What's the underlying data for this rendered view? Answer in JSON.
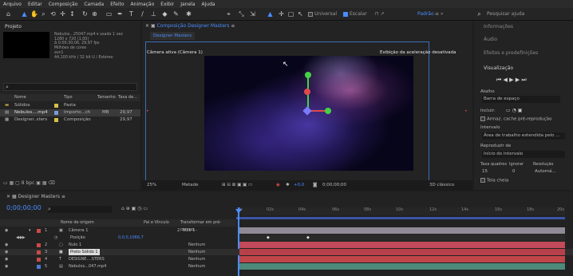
{
  "menubar": [
    "Arquivo",
    "Editar",
    "Composição",
    "Camada",
    "Efeito",
    "Animação",
    "Exibir",
    "Janela",
    "Ajuda"
  ],
  "toolbar": {
    "universal_label": "Universal",
    "escalar_label": "Escalar",
    "padrao_label": "Padrão",
    "search_placeholder": "Pesquisar ajuda"
  },
  "project": {
    "title": "Projeto",
    "info_lines": [
      "Nebulos...25047.mp4 ▾ usado 1 vez",
      "1280 x 720 (1,00)",
      "Δ 0;00;30;06, 29,97 fps",
      "Milhões de cores",
      "avc1",
      "44,100 kHz / 32 bit U / Estéreo"
    ],
    "columns": [
      "Nome",
      "Tipo",
      "Tamanho",
      "Taxa de..."
    ],
    "items": [
      {
        "name": "Sólidos",
        "type": "Pasta",
        "size": "",
        "rate": "",
        "color": "#d4c24a"
      },
      {
        "name": "Nebulos....mp4",
        "type": "Importo...ch",
        "size": "MB",
        "rate": "29,97",
        "color": "#7a9ad8"
      },
      {
        "name": "Designer..sters",
        "type": "Composição",
        "size": "",
        "rate": "29,97",
        "color": "#d4c24a"
      }
    ],
    "bpc": "8 bpc"
  },
  "composition": {
    "tab": "Composição Designer Masters",
    "sub_tab": "Designer Masters",
    "active_camera": "Câmera ativa (Câmera 1)",
    "accel_note": "Exibição da aceleração desativada",
    "zoom": "25%",
    "quality": "Metade",
    "timecode": "0;00;00;00",
    "view": "3D clássico",
    "exposure": "+0,0"
  },
  "right_panel": {
    "items": [
      "Informações",
      "Áudio",
      "Efeitos e predefinições"
    ],
    "visualization": "Visualização",
    "shortcut_label": "Atalho",
    "shortcut_value": "Barra de espaço",
    "include_label": "Incluir:",
    "cache_label": "Armaz. cache pré-reprodução",
    "interval_label": "Intervalo",
    "interval_value": "Área de trabalho estendida pelo ...",
    "play_from_label": "Reproduzir de",
    "play_from_value": "Início do intervalo",
    "fps_label": "Taxa quadros",
    "skip_label": "Ignorar",
    "res_label": "Resolução",
    "fps_value": "15",
    "skip_value": "0",
    "res_value": "Automá...",
    "fullscreen_label": "Tela cheia"
  },
  "timeline": {
    "tab": "Designer Masters",
    "timecode": "0;00;00;00",
    "columns": [
      "Nome de origem",
      "Pai e Vínculo",
      "Transformar em pré-compo..."
    ],
    "layers": [
      {
        "num": "1",
        "name": "Câmera 1",
        "parent": "2. Nulo 1",
        "color": "#c94a4a",
        "bar": "#9a8f9a"
      },
      {
        "num": "",
        "name": "Posição",
        "parent": "",
        "color": "",
        "value": "0,0,0,1066,7",
        "bar": ""
      },
      {
        "num": "2",
        "name": "Nulo 1",
        "parent": "Nenhum",
        "color": "#c94a4a",
        "bar": "#c24a5a"
      },
      {
        "num": "3",
        "name": "Preto Sólido 1",
        "parent": "Nenhum",
        "color": "#c94a4a",
        "bar": "#b8404a"
      },
      {
        "num": "4",
        "name": "DESIGNE....STERS",
        "parent": "Nenhum",
        "color": "#c94a4a",
        "bar": "#c0464a"
      },
      {
        "num": "5",
        "name": "Nebulos...047.mp4",
        "parent": "Nenhum",
        "color": "#4a7ad8",
        "bar": "#4e8a7a"
      }
    ],
    "ruler": [
      "0s",
      "02s",
      "04s",
      "06s",
      "08s",
      "10s",
      "12s",
      "14s",
      "16s",
      "18s",
      "20s"
    ]
  }
}
